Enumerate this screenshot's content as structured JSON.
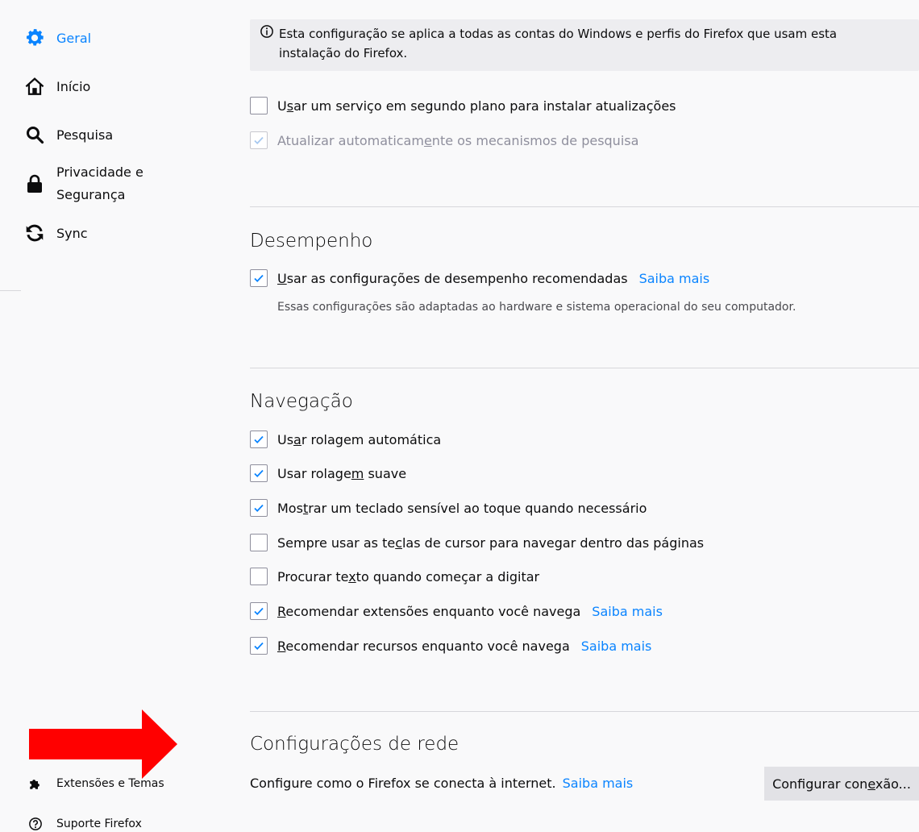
{
  "sidebar": {
    "items": [
      {
        "label": "Geral",
        "icon": "gear-icon",
        "selected": true
      },
      {
        "label": "Início",
        "icon": "home-icon"
      },
      {
        "label": "Pesquisa",
        "icon": "search-icon"
      },
      {
        "label_line1": "Privacidade e",
        "label_line2": "Segurança",
        "icon": "lock-icon"
      },
      {
        "label": "Sync",
        "icon": "sync-icon"
      }
    ],
    "bottom": [
      {
        "label": "Extensões e Temas",
        "icon": "puzzle-icon"
      },
      {
        "label": "Suporte Firefox",
        "icon": "help-icon"
      }
    ]
  },
  "info": {
    "line1": "Esta configuração se aplica a todas as contas do Windows e perfis do Firefox que usam esta",
    "line2": "instalação do Firefox."
  },
  "updates": {
    "background_service": {
      "pre": "U",
      "key": "s",
      "post": "ar um serviço em segundo plano para instalar atualizações",
      "checked": false
    },
    "search_engines": {
      "pre": "Atualizar automaticam",
      "key": "e",
      "post": "nte os mecanismos de pesquisa",
      "checked": true
    }
  },
  "performance": {
    "title": "Desempenho",
    "recommended": {
      "pre": "",
      "key": "U",
      "post": "sar as configurações de desempenho recomendadas",
      "checked": true
    },
    "learn_more": "Saiba mais",
    "description": "Essas configurações são adaptadas ao hardware e sistema operacional do seu computador."
  },
  "browsing": {
    "title": "Navegação",
    "items": [
      {
        "pre": "Us",
        "key": "a",
        "post": "r rolagem automática",
        "checked": true
      },
      {
        "pre": "Usar rolage",
        "key": "m",
        "post": " suave",
        "checked": true
      },
      {
        "pre": "Mos",
        "key": "t",
        "post": "rar um teclado sensível ao toque quando necessário",
        "checked": true
      },
      {
        "pre": "Sempre usar as te",
        "key": "c",
        "post": "las de cursor para navegar dentro das páginas",
        "checked": false
      },
      {
        "pre": "Procurar te",
        "key": "x",
        "post": "to quando começar a digitar",
        "checked": false
      },
      {
        "pre": "",
        "key": "R",
        "post": "ecomendar extensões enquanto você navega",
        "checked": true,
        "link": "Saiba mais"
      },
      {
        "pre": "",
        "key": "R",
        "post": "ecomendar recursos enquanto você navega",
        "checked": true,
        "link": "Saiba mais"
      }
    ]
  },
  "network": {
    "title": "Configurações de rede",
    "description": "Configure como o Firefox se conecta à internet.",
    "learn_more": "Saiba mais",
    "button": {
      "pre": "Configurar con",
      "key": "e",
      "post": "xão..."
    }
  },
  "colors": {
    "accent": "#0a84ff",
    "arrow": "#ff0000",
    "background": "#f9f9fa"
  }
}
